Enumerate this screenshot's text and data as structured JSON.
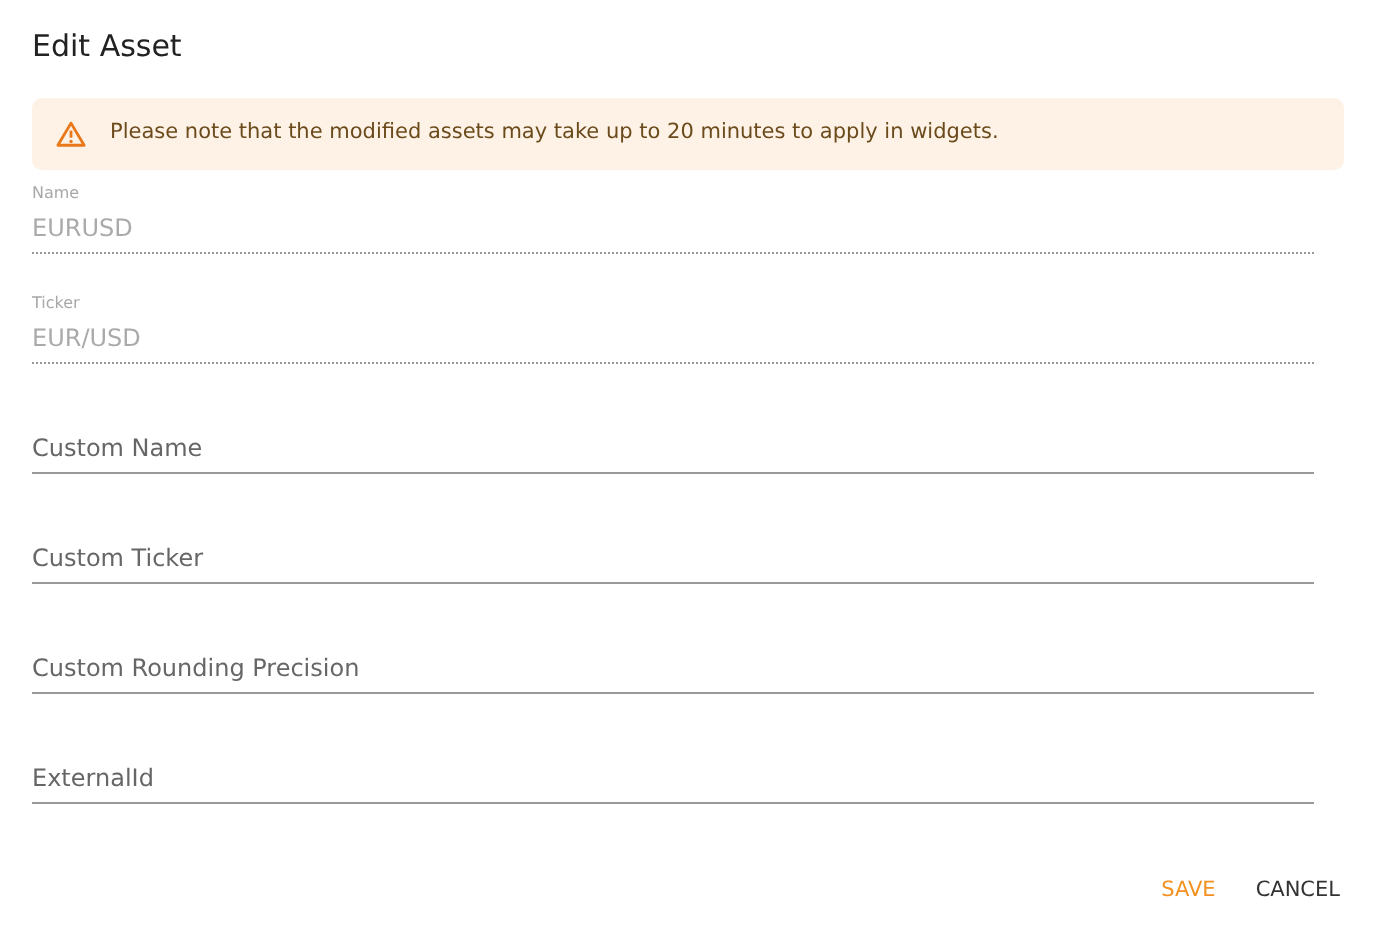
{
  "dialog": {
    "title": "Edit Asset"
  },
  "alert": {
    "message": "Please note that the modified assets may take up to 20 minutes to apply in widgets."
  },
  "fields": [
    {
      "label": "Name",
      "value": "EURUSD",
      "disabled": true
    },
    {
      "label": "Ticker",
      "value": "EUR/USD",
      "disabled": true
    },
    {
      "placeholder": "Custom Name",
      "disabled": false
    },
    {
      "placeholder": "Custom Ticker",
      "disabled": false
    },
    {
      "placeholder": "Custom Rounding Precision",
      "disabled": false
    },
    {
      "placeholder": "ExternalId",
      "disabled": false
    }
  ],
  "buttons": [
    {
      "label": "SAVE",
      "kind": "primary"
    },
    {
      "label": "CANCEL",
      "kind": "secondary"
    }
  ]
}
